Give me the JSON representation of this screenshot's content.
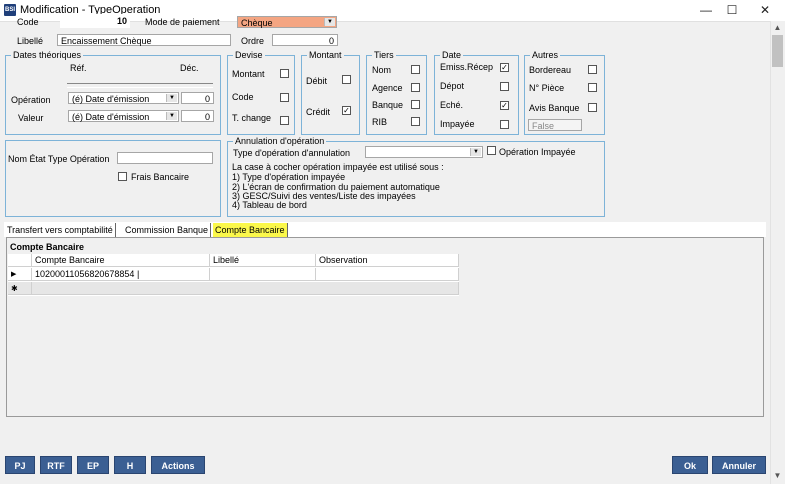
{
  "window": {
    "title": "Modification - TypeOperation",
    "app_badge": "BSI"
  },
  "controls": {
    "minimize": "—",
    "maximize": "☐",
    "close": "✕"
  },
  "form": {
    "code_label": "Code",
    "code_value": "10",
    "mode_label": "Mode de paiement",
    "mode_value": "Chèque",
    "libelle_label": "Libellé",
    "libelle_value": "Encaissement Chèque",
    "ordre_label": "Ordre",
    "ordre_value": "0"
  },
  "dates": {
    "title": "Dates théoriques",
    "ref_header": "Réf.",
    "dec_header": "Déc.",
    "operation_label": "Opération",
    "operation_value": "(é) Date d'émission",
    "operation_dec": "0",
    "valeur_label": "Valeur",
    "valeur_value": "(é) Date d'émission",
    "valeur_dec": "0"
  },
  "devise": {
    "title": "Devise",
    "montant": "Montant",
    "code": "Code",
    "tchange": "T. change"
  },
  "montant": {
    "title": "Montant",
    "debit": "Débit",
    "credit": "Crédit"
  },
  "tiers": {
    "title": "Tiers",
    "nom": "Nom",
    "agence": "Agence",
    "banque": "Banque",
    "rib": "RIB"
  },
  "date": {
    "title": "Date",
    "emiss": "Emiss.Récep",
    "depot": "Dépot",
    "eche": "Eché.",
    "impayee": "Impayée"
  },
  "autres": {
    "title": "Autres",
    "bordereau": "Bordereau",
    "npiece": "N° Pièce",
    "avis": "Avis Banque",
    "false_value": "False"
  },
  "etat": {
    "label": "Nom État Type Opération",
    "frais": "Frais Bancaire"
  },
  "annulation": {
    "title": "Annulation d'opération",
    "type_label": "Type d'opération d'annulation",
    "impayee_label": "Opération Impayée",
    "note": "La case à cocher opération impayée est utilisé sous :",
    "items": [
      "1) Type d'opération impayée",
      "2) L'écran de confirmation du paiement automatique",
      "3) GESC/Suivi des ventes/Liste des impayées",
      "4) Tableau de bord"
    ]
  },
  "tabs": [
    "Transfert vers comptabilité",
    "Commission Banque",
    "Compte Bancaire"
  ],
  "grid": {
    "title": "Compte Bancaire",
    "columns": [
      "Compte Bancaire",
      "Libellé",
      "Observation"
    ],
    "rows": [
      [
        "10200011056820678854 |",
        "",
        ""
      ]
    ],
    "row_marker": "▶",
    "new_marker": "✱"
  },
  "buttons": {
    "pj": "PJ",
    "rtf": "RTF",
    "ep": "EP",
    "h": "H",
    "actions": "Actions",
    "ok": "Ok",
    "annuler": "Annuler"
  },
  "colors": {
    "mode_field": "#f4a582",
    "highlight": "#fbf84a",
    "button": "#3b5f93",
    "group_border": "#7db3d8"
  }
}
